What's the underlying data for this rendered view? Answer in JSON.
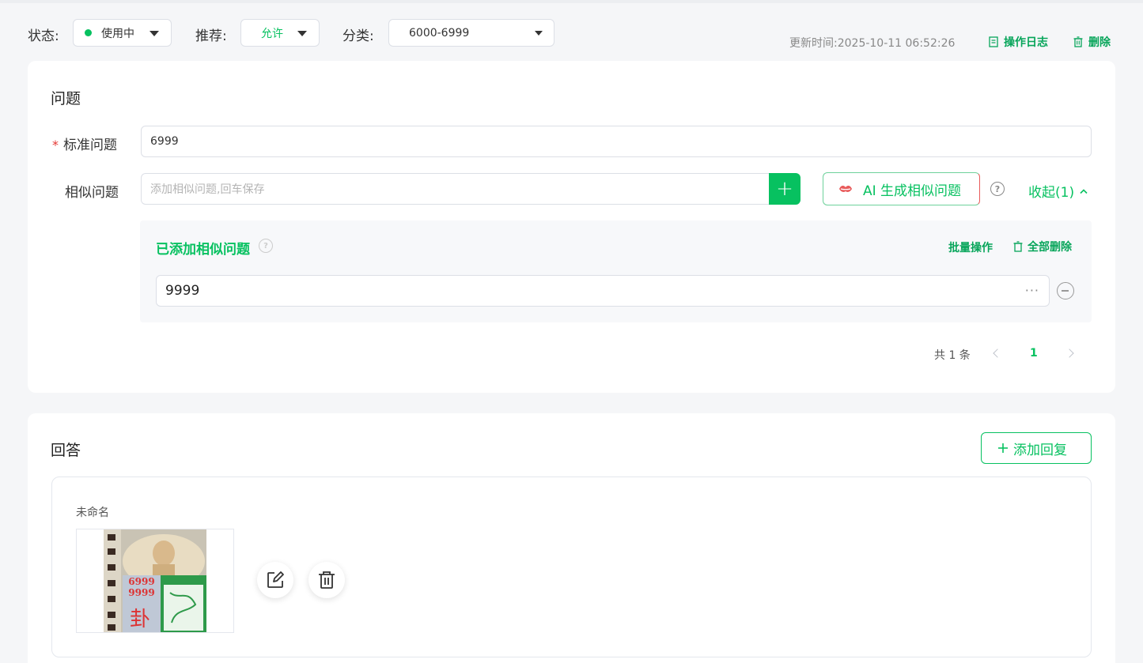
{
  "filters": {
    "status_label": "状态:",
    "status_value": "使用中",
    "recommend_label": "推荐:",
    "recommend_value": "允许",
    "category_label": "分类:",
    "category_value": "6000-6999"
  },
  "header": {
    "updated_time": "更新时间:2025-10-11 06:52:26",
    "log_link": "操作日志",
    "delete_link": "删除"
  },
  "question_section": {
    "title": "问题",
    "standard_label": "标准问题",
    "required_mark": "*",
    "standard_value": "6999",
    "similar_label": "相似问题",
    "similar_placeholder": "添加相似问题,回车保存",
    "add_icon": "+",
    "ai_button": "AI 生成相似问题",
    "help_icon": "?",
    "collapse_link": "收起(1)",
    "added_title": "已添加相似问题",
    "batch_link": "批量操作",
    "delete_all_link": "全部删除",
    "similar_items": [
      "9999"
    ],
    "more_icon": "···",
    "pager": {
      "total": "共 1 条",
      "current_page": "1"
    }
  },
  "answer_section": {
    "title": "回答",
    "add_reply_button": "添加回复",
    "reply": {
      "name": "未命名",
      "image_text": {
        "numbers_top": "6999",
        "numbers_bottom": "9999",
        "big_char": "卦"
      }
    }
  },
  "colors": {
    "accent": "#07c160",
    "required": "#e53935",
    "page_bg": "#f5f6f8"
  },
  "icons": {
    "log": "document-icon",
    "delete": "trash-icon",
    "ai": "ai-lips-icon",
    "edit": "edit-icon",
    "trash": "trash-icon"
  }
}
